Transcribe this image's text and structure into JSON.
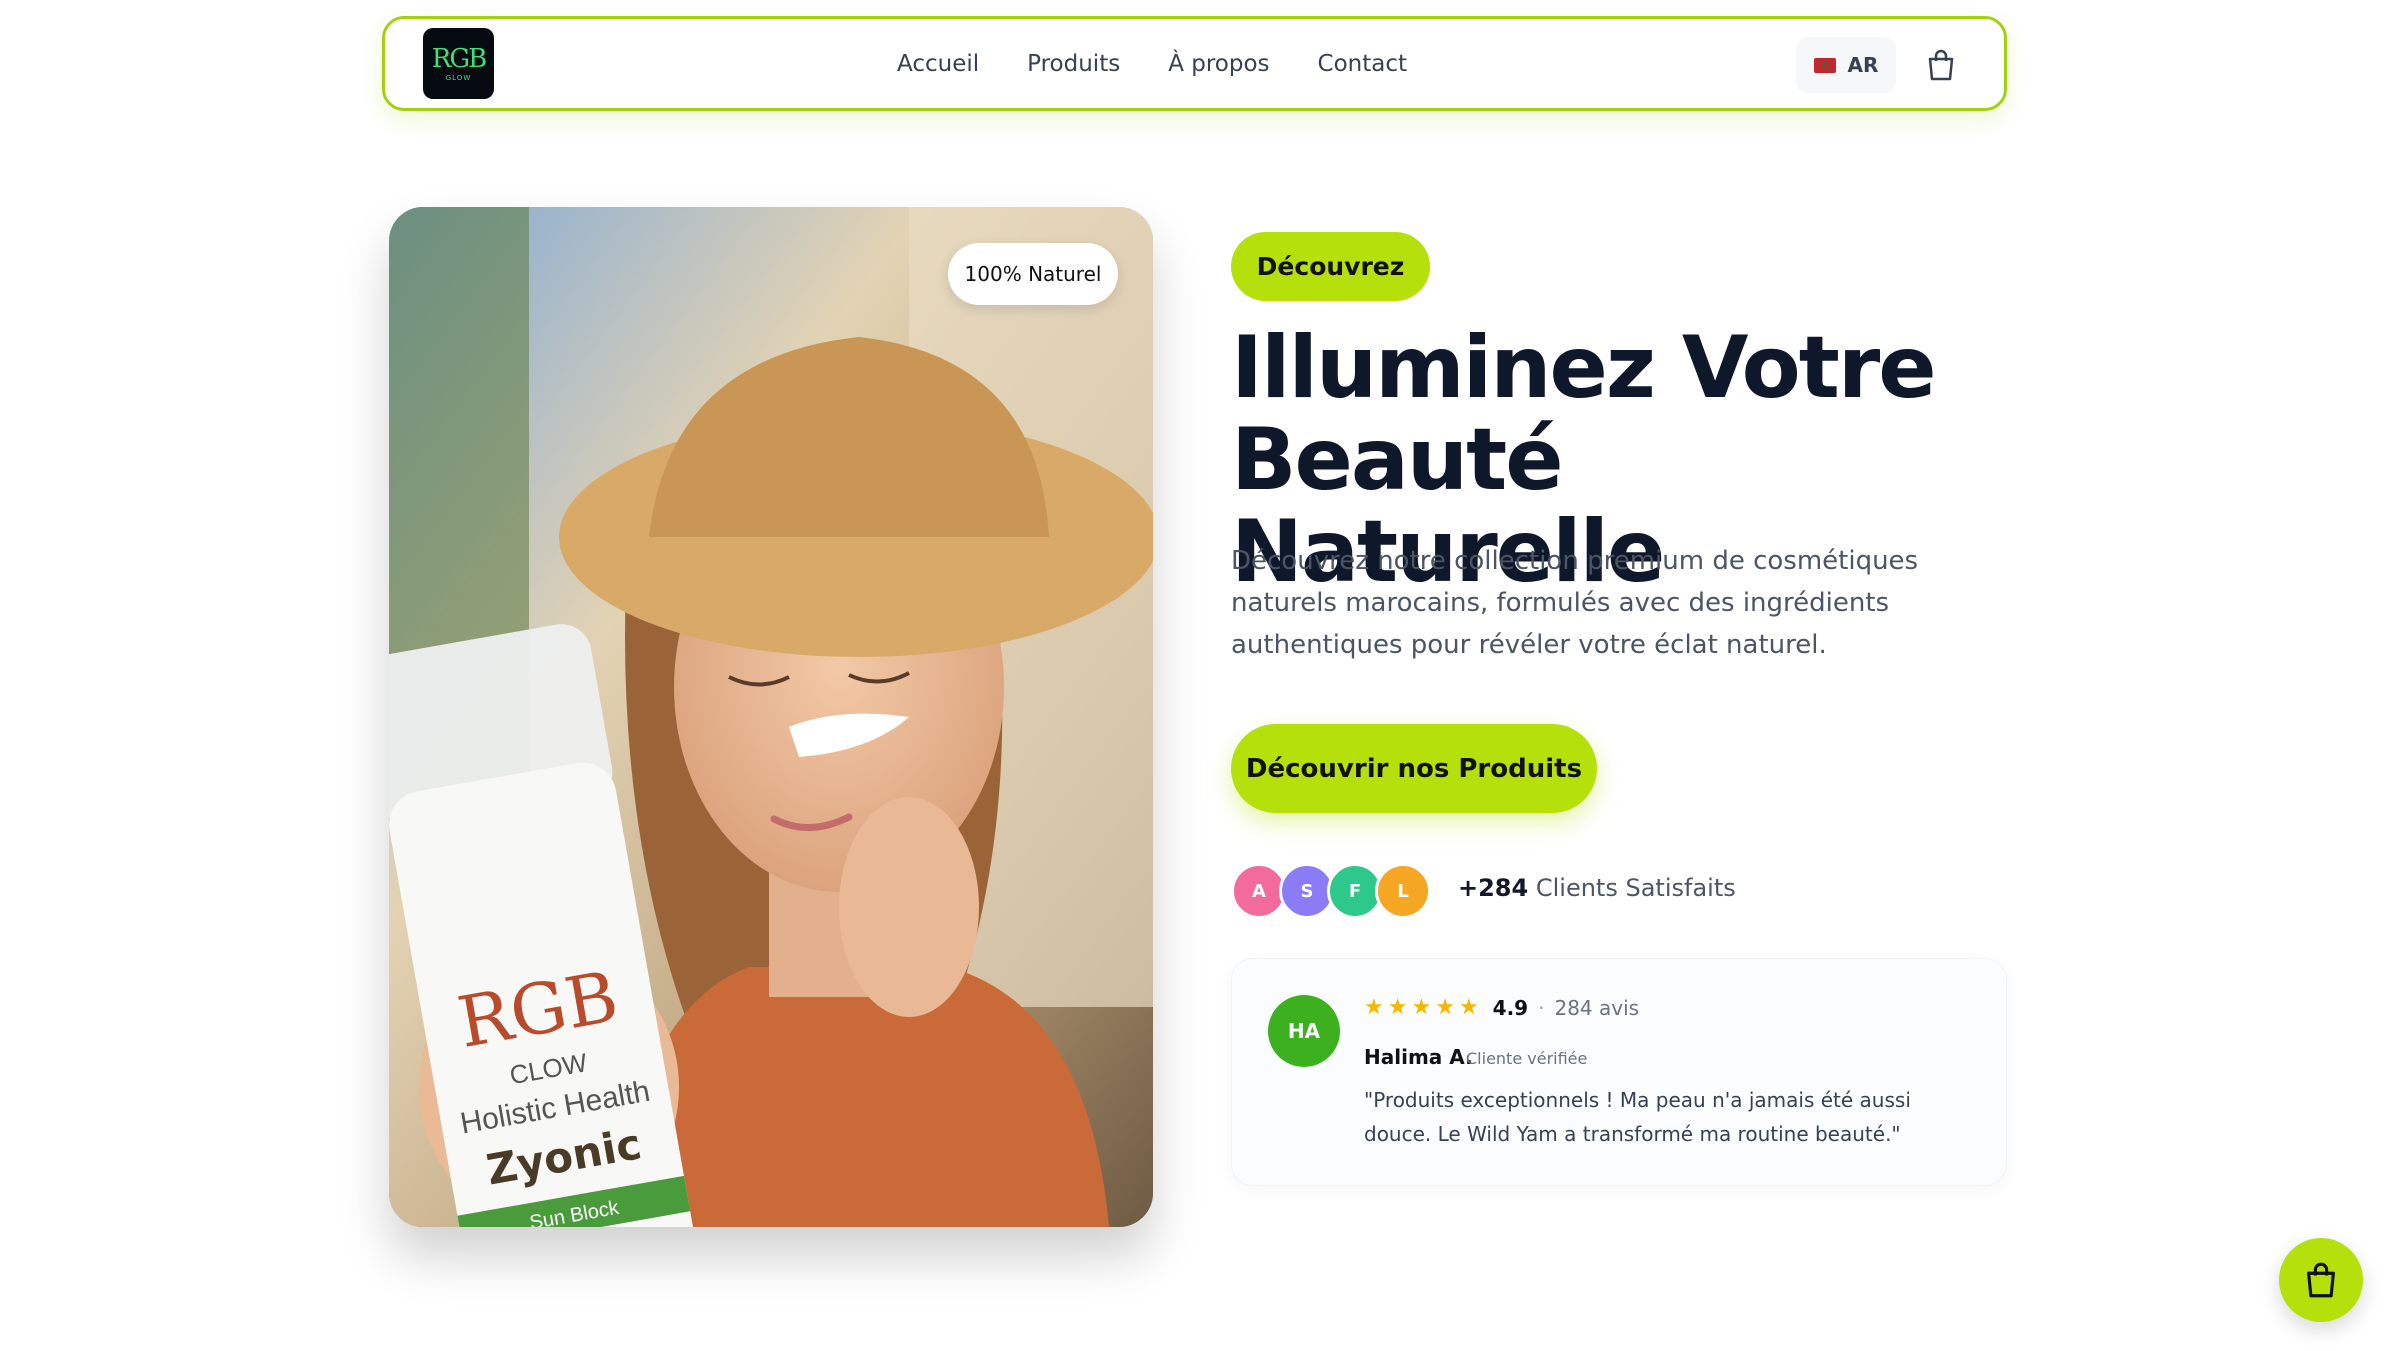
{
  "brand": {
    "logo_text": "RGB",
    "logo_sub": "GLOW"
  },
  "nav": {
    "links": [
      "Accueil",
      "Produits",
      "À propos",
      "Contact"
    ],
    "lang": "AR"
  },
  "hero": {
    "badge": "100% Naturel",
    "product": {
      "brand": "RGB",
      "line": "CLOW",
      "tagline": "Holistic Health",
      "name": "Zyonic",
      "type": "Sun Block"
    },
    "tag": "Découvrez",
    "title_line1": "Illuminez Votre",
    "title_line2": "Beauté Naturelle",
    "description": "Découvrez notre collection premium de cosmétiques naturels marocains, formulés avec des ingrédients authentiques pour révéler votre éclat naturel.",
    "cta": "Découvrir nos Produits"
  },
  "social_proof": {
    "avatars": [
      {
        "letter": "A",
        "color": "#f26b9a"
      },
      {
        "letter": "S",
        "color": "#8b7cf6"
      },
      {
        "letter": "F",
        "color": "#2cc98a"
      },
      {
        "letter": "L",
        "color": "#f5a623"
      }
    ],
    "count": "+284",
    "label": "Clients Satisfaits"
  },
  "review": {
    "initials": "HA",
    "rating": "4.9",
    "reviews": "284 avis",
    "name": "Halima A.",
    "verified": "Cliente vérifiée",
    "text": "\"Produits exceptionnels ! Ma peau n'a jamais été aussi douce. Le Wild Yam a transformé ma routine beauté.\""
  },
  "colors": {
    "accent": "#b6e00c",
    "text_dark": "#0f172a"
  }
}
